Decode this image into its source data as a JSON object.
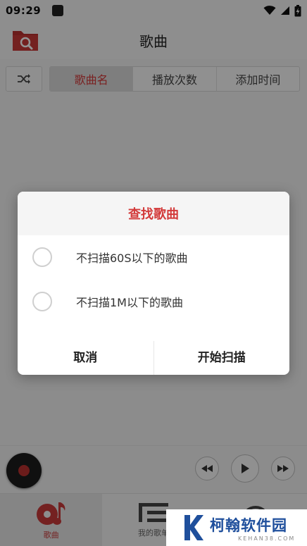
{
  "status_bar": {
    "time": "09:29",
    "icons": [
      "notification-square-icon",
      "wifi-icon",
      "cellular-signal-icon",
      "battery-icon"
    ]
  },
  "app_bar": {
    "title": "歌曲",
    "left_icon": "folder-search-icon"
  },
  "sort_bar": {
    "shuffle_icon": "shuffle-icon",
    "options": [
      {
        "label": "歌曲名",
        "active": true
      },
      {
        "label": "播放次数",
        "active": false
      },
      {
        "label": "添加时间",
        "active": false
      }
    ]
  },
  "player": {
    "disc_icon": "vinyl-disc-icon",
    "controls": [
      "previous-icon",
      "play-icon",
      "next-icon"
    ]
  },
  "bottom_nav": {
    "items": [
      {
        "label": "歌曲",
        "icon": "music-disc-icon",
        "active": true
      },
      {
        "label": "我的歌单",
        "icon": "playlist-icon",
        "active": false
      },
      {
        "label": "",
        "icon": "podcast-icon",
        "active": false
      }
    ]
  },
  "dialog": {
    "title": "查找歌曲",
    "options": [
      {
        "label": "不扫描60S以下的歌曲",
        "checked": false
      },
      {
        "label": "不扫描1M以下的歌曲",
        "checked": false
      }
    ],
    "cancel_label": "取消",
    "confirm_label": "开始扫描"
  },
  "watermark": {
    "name": "柯翰软件园",
    "site": "KEHAN38.COM"
  },
  "colors": {
    "accent": "#d33a3a",
    "watermark_blue": "#1f4f9c"
  }
}
